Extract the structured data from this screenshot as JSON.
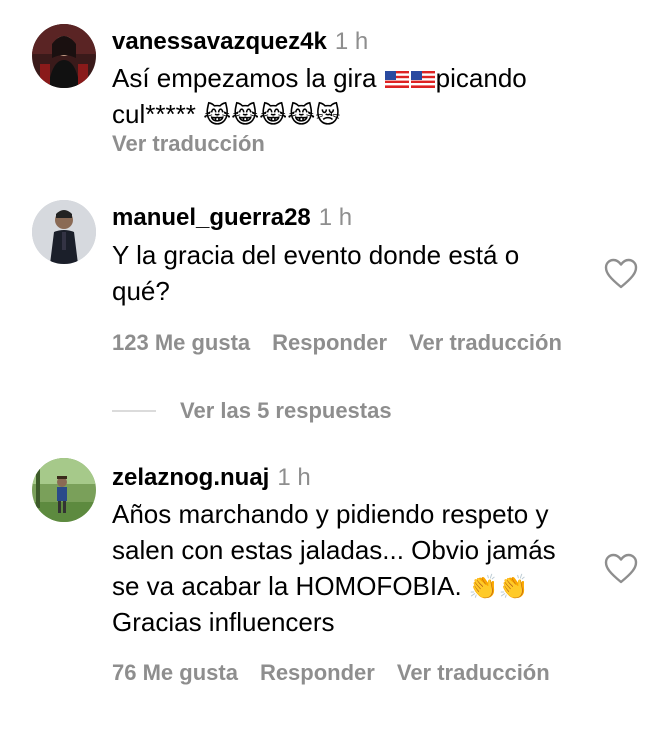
{
  "comments": [
    {
      "username": "vanessavazquez4k",
      "time": "1 h",
      "text_a": "Así empezamos la gira ",
      "text_b": "picando cul*****",
      "emojis": "😹😹😹😹😿",
      "translate_label": "Ver traducción"
    },
    {
      "username": "manuel_guerra28",
      "time": "1 h",
      "text": "Y la gracia del evento donde está o qué?",
      "likes": "123 Me gusta",
      "reply_label": "Responder",
      "translate_label": "Ver traducción",
      "view_replies": "Ver las 5 respuestas"
    },
    {
      "username": "zelaznog.nuaj",
      "time": "1 h",
      "text": "Años marchando y pidiendo respeto y salen con estas jaladas... Obvio jamás se va acabar la HOMOFOBIA.",
      "emojis": "👏👏",
      "text_end": "Gracias influencers",
      "likes": "76 Me gusta",
      "reply_label": "Responder",
      "translate_label": "Ver traducción"
    }
  ],
  "icons": {
    "heart": "heart-outline-icon",
    "flag": "us-flag-icon"
  },
  "colors": {
    "secondary_text": "#8e8e8e",
    "divider": "#dbdbdb"
  }
}
